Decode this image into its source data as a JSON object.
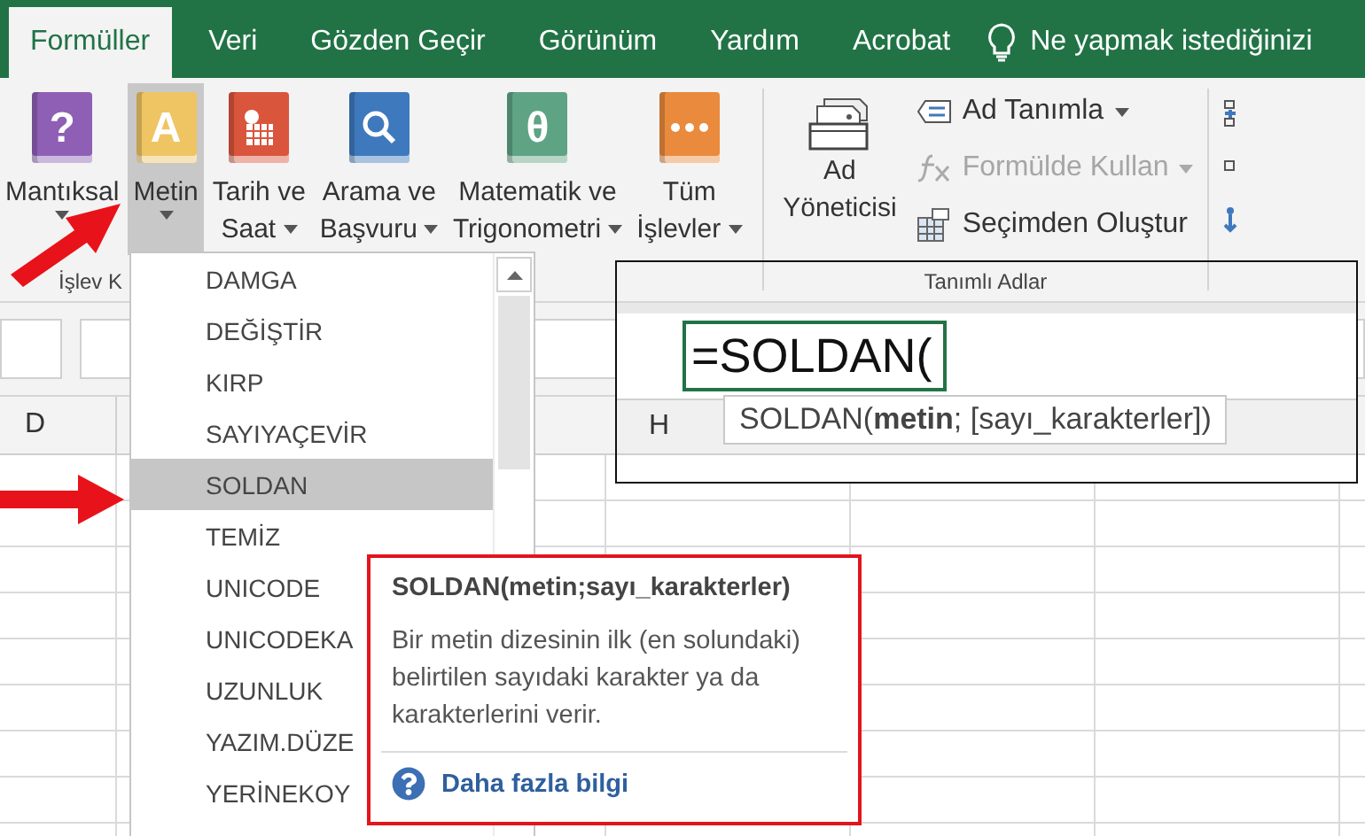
{
  "tabs": [
    {
      "label": "Formüller",
      "selected": true
    },
    {
      "label": "Veri",
      "selected": false
    },
    {
      "label": "Gözden Geçir",
      "selected": false
    },
    {
      "label": "Görünüm",
      "selected": false
    },
    {
      "label": "Yardım",
      "selected": false
    },
    {
      "label": "Acrobat",
      "selected": false
    }
  ],
  "tell_me": {
    "text": "Ne yapmak istediğinizi"
  },
  "ribbon": {
    "function_library": {
      "label": "İşlev K",
      "buttons": [
        {
          "lines": [
            "Mantıksal"
          ],
          "kind": "glyph",
          "glyph": "?",
          "color": "#8e5fb5",
          "menu": true,
          "pressed": false
        },
        {
          "lines": [
            "Metin"
          ],
          "kind": "glyph",
          "glyph": "A",
          "color": "#efc463",
          "menu": true,
          "pressed": true
        },
        {
          "lines": [
            "Tarih ve",
            "Saat"
          ],
          "kind": "calendar",
          "color": "#d9553c",
          "menu": true,
          "pressed": false
        },
        {
          "lines": [
            "Arama ve",
            "Başvuru"
          ],
          "kind": "search",
          "color": "#3e79bd",
          "menu": true,
          "pressed": false
        },
        {
          "lines": [
            "Matematik ve",
            "Trigonometri"
          ],
          "kind": "glyph",
          "glyph": "θ",
          "color": "#5ea384",
          "menu": true,
          "pressed": false
        },
        {
          "lines": [
            "Tüm",
            "İşlevler"
          ],
          "kind": "dots",
          "color": "#ea8a3c",
          "menu": true,
          "pressed": false
        }
      ]
    },
    "defined_names": {
      "label": "Tanımlı Adlar",
      "manager": {
        "lines": [
          "Ad",
          "Yöneticisi"
        ]
      },
      "commands": [
        {
          "label": "Ad Tanımla",
          "kind": "tag",
          "menu": true,
          "disabled": false
        },
        {
          "label": "Formülde Kullan",
          "kind": "fx",
          "menu": true,
          "disabled": true
        },
        {
          "label": "Seçimden Oluştur",
          "kind": "table",
          "menu": false,
          "disabled": false
        }
      ]
    }
  },
  "sheet": {
    "column_header": "D"
  },
  "function_menu": {
    "items": [
      {
        "label": "DAMGA",
        "selected": false
      },
      {
        "label": "DEĞİŞTİR",
        "selected": false
      },
      {
        "label": "KIRP",
        "selected": false
      },
      {
        "label": "SAYIYAÇEVİR",
        "selected": false
      },
      {
        "label": "SOLDAN",
        "selected": true
      },
      {
        "label": "TEMİZ",
        "selected": false
      },
      {
        "label": "UNICODE",
        "selected": false
      },
      {
        "label": "UNICODEKA",
        "selected": false
      },
      {
        "label": "UZUNLUK",
        "selected": false
      },
      {
        "label": "YAZIM.DÜZE",
        "selected": false
      },
      {
        "label": "YERİNEKOY",
        "selected": false
      }
    ]
  },
  "zoom_inset": {
    "cell_formula": "=SOLDAN(",
    "column_header": "H",
    "hint": "SOLDAN(**metin**; [sayı_karakterler])"
  },
  "tooltip": {
    "title": "SOLDAN(metin;sayı_karakterler)",
    "description": "Bir metin dizesinin ilk (en solundaki) belirtilen sayıdaki karakter ya da karakterlerini verir.",
    "link": "Daha fazla bilgi"
  }
}
